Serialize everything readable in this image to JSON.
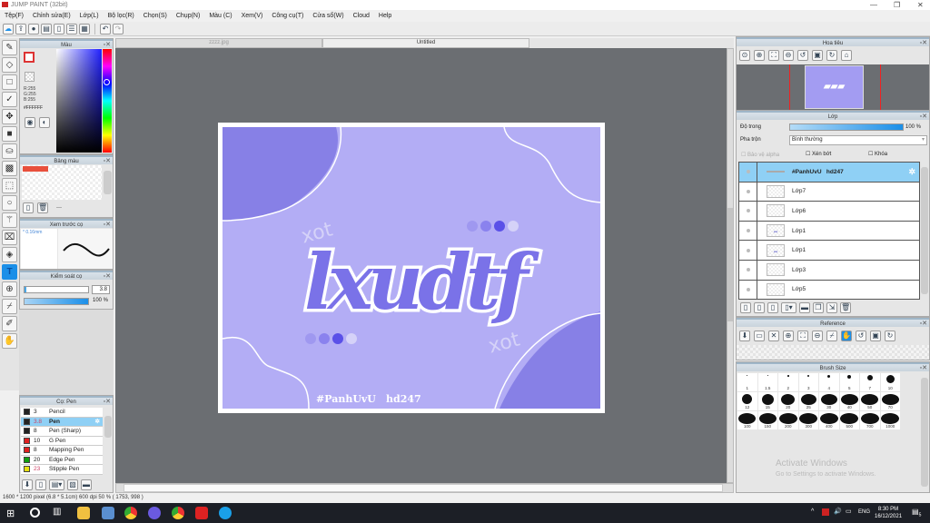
{
  "app": {
    "title": "JUMP PAINT (32bit)"
  },
  "menu": [
    "Tệp(F)",
    "Chỉnh sửa(E)",
    "Lớp(L)",
    "Bộ lọc(R)",
    "Chọn(S)",
    "Chụp(N)",
    "Màu (C)",
    "Xem(V)",
    "Công cụ(T)",
    "Cửa sổ(W)",
    "Cloud",
    "Help"
  ],
  "tabs": [
    "zzzz.jpg",
    "Untitled"
  ],
  "color_panel": {
    "title": "Màu",
    "r": "R:255",
    "g": "G:255",
    "b": "B:255",
    "hex": "#FFFFFF"
  },
  "palette_panel": {
    "title": "Bảng màu",
    "dash": "---"
  },
  "brush_preview": {
    "title": "Xem trước cọ",
    "size": "* 0.16mm"
  },
  "brush_control": {
    "title": "Kiểm soát cọ",
    "size": "3.8",
    "opacity": "100 %",
    "opacity_value": 100
  },
  "brush_list": {
    "title": "Cọ: Pen",
    "items": [
      {
        "size": "3",
        "name": "Pencil",
        "color": "#222222"
      },
      {
        "size": "3.8",
        "name": "Pen",
        "color": "#222222",
        "selected": true
      },
      {
        "size": "8",
        "name": "Pen (Sharp)",
        "color": "#222222"
      },
      {
        "size": "10",
        "name": "G Pen",
        "color": "#e02020"
      },
      {
        "size": "8",
        "name": "Mapping Pen",
        "color": "#e02020"
      },
      {
        "size": "20",
        "name": "Edge Pen",
        "color": "#10a010"
      },
      {
        "size": "23",
        "name": "Stipple Pen",
        "color": "#e8e010"
      }
    ]
  },
  "status": "1600 * 1200 pixel   (6.8 * 5.1cm)   600 dpi   50 %   ( 1753, 998 )",
  "artwork": {
    "hashtag": "#PanhUvU",
    "credit": "hd247",
    "title_art": "lxudtf",
    "xot": "xot"
  },
  "navigator": {
    "title": "Hoa tiêu"
  },
  "layers": {
    "title": "Lớp",
    "opacity_label": "Độ trong",
    "opacity": "100 %",
    "opacity_value": 100,
    "blend_label": "Pha trộn",
    "blend": "Bình thường",
    "protect_alpha": "Bảo vệ alpha",
    "clip": "Xén bớt",
    "lock": "Khóa",
    "items": [
      "#PanhUvU   hd247",
      "Lớp7",
      "Lớp6",
      "Lớp1",
      "Lớp1",
      "Lớp3",
      "Lớp5"
    ]
  },
  "reference": {
    "title": "Reference"
  },
  "brush_size": {
    "title": "Brush Size",
    "sizes": [
      "1",
      "1.5",
      "2",
      "3",
      "4",
      "5",
      "7",
      "10",
      "12",
      "15",
      "20",
      "25",
      "30",
      "40",
      "50",
      "70",
      "100",
      "150",
      "200",
      "300",
      "400",
      "500",
      "700",
      "1000"
    ]
  },
  "watermark": {
    "line1": "Activate Windows",
    "line2": "Go to Settings to activate Windows."
  },
  "tray": {
    "lang": "ENG",
    "time": "8:30 PM",
    "date": "16/12/2021",
    "notif": "5"
  },
  "colors": {
    "accent": "#1b8fe8",
    "canvas_bg": "#6b6e72",
    "art_bg": "#b3adf5",
    "art_dark": "#8780e6"
  }
}
